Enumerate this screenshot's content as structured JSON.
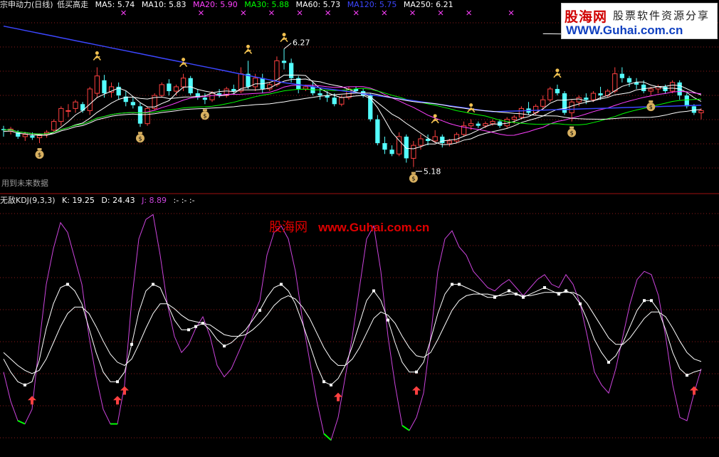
{
  "colors": {
    "background": "#000000",
    "grid": "#8b1a1a",
    "divider": "#a01010",
    "up_candle": "#ff4040",
    "down_candle": "#54ffff",
    "ma5": "#ffffff",
    "ma10": "#ffffff",
    "ma20": "#ff40ff",
    "ma30": "#00ff00",
    "ma60": "#ffffff",
    "ma120": "#3c46ff",
    "ma250": "#ffffff",
    "kdj_k": "#ffffff",
    "kdj_d": "#ffffff",
    "kdj_j": "#cc44dd",
    "j_low": "#00ff00",
    "buy_arrow": "#ff4040"
  },
  "top_panel": {
    "title": "宗申动力(日线)",
    "formula": "低买高走",
    "indicators": [
      {
        "label": "MA5: 5.74",
        "color": "#ffffff"
      },
      {
        "label": "MA10: 5.83",
        "color": "#ffffff"
      },
      {
        "label": "MA20: 5.90",
        "color": "#ff40ff"
      },
      {
        "label": "MA30: 5.88",
        "color": "#00ff00"
      },
      {
        "label": "MA60: 5.73",
        "color": "#ffffff"
      },
      {
        "label": "MA120: 5.75",
        "color": "#3c46ff"
      },
      {
        "label": "MA250: 6.21",
        "color": "#ffffff"
      }
    ],
    "footnote": "用到未来数据",
    "high_label": "6.27",
    "low_label": "5.18"
  },
  "bottom_panel": {
    "name": "无敌KDJ(9,3,3)",
    "values": [
      {
        "label": "K: 19.25",
        "color": "#ffffff"
      },
      {
        "label": "D: 24.43",
        "color": "#ffffff"
      },
      {
        "label": "J: 8.89",
        "color": "#cc44dd"
      },
      {
        "label": ":-  :-  :-",
        "color": "#ffffff"
      }
    ]
  },
  "logo": {
    "name": "股海网",
    "slogan": "股票软件资源分享",
    "url": "WWW.Guhai.com.cn"
  },
  "watermark": {
    "name": "股海网",
    "url": "www.Guhai.com.cn"
  },
  "chart_data": [
    {
      "type": "candlestick",
      "price_range": [
        5.0,
        6.55
      ],
      "candles": [
        [
          5.53,
          5.56,
          5.46,
          5.52
        ],
        [
          5.51,
          5.55,
          5.48,
          5.53
        ],
        [
          5.5,
          5.52,
          5.44,
          5.46
        ],
        [
          5.46,
          5.5,
          5.42,
          5.48
        ],
        [
          5.47,
          5.5,
          5.43,
          5.45
        ],
        [
          5.45,
          5.49,
          5.4,
          5.47
        ],
        [
          5.48,
          5.52,
          5.45,
          5.5
        ],
        [
          5.52,
          5.62,
          5.5,
          5.6
        ],
        [
          5.6,
          5.74,
          5.56,
          5.72
        ],
        [
          5.7,
          5.76,
          5.64,
          5.7
        ],
        [
          5.72,
          5.8,
          5.68,
          5.78
        ],
        [
          5.76,
          5.78,
          5.68,
          5.7
        ],
        [
          5.7,
          5.92,
          5.66,
          5.9
        ],
        [
          5.86,
          6.1,
          5.82,
          6.02
        ],
        [
          5.98,
          6.03,
          5.82,
          5.86
        ],
        [
          5.87,
          5.96,
          5.82,
          5.92
        ],
        [
          5.92,
          5.96,
          5.8,
          5.84
        ],
        [
          5.83,
          5.88,
          5.74,
          5.78
        ],
        [
          5.78,
          5.82,
          5.72,
          5.75
        ],
        [
          5.74,
          5.77,
          5.55,
          5.58
        ],
        [
          5.58,
          5.74,
          5.56,
          5.72
        ],
        [
          5.72,
          5.86,
          5.7,
          5.84
        ],
        [
          5.84,
          5.96,
          5.82,
          5.94
        ],
        [
          5.95,
          5.99,
          5.84,
          5.88
        ],
        [
          5.88,
          5.94,
          5.84,
          5.92
        ],
        [
          5.92,
          6.04,
          5.88,
          6.0
        ],
        [
          6.0,
          6.02,
          5.84,
          5.86
        ],
        [
          5.86,
          5.9,
          5.8,
          5.82
        ],
        [
          5.82,
          5.86,
          5.76,
          5.8
        ],
        [
          5.8,
          5.88,
          5.78,
          5.86
        ],
        [
          5.86,
          5.9,
          5.82,
          5.84
        ],
        [
          5.84,
          5.92,
          5.82,
          5.9
        ],
        [
          5.9,
          5.94,
          5.86,
          5.88
        ],
        [
          5.88,
          6.1,
          5.86,
          6.04
        ],
        [
          6.04,
          6.16,
          5.9,
          5.92
        ],
        [
          5.92,
          6.04,
          5.88,
          6.0
        ],
        [
          6.0,
          6.04,
          5.86,
          5.9
        ],
        [
          5.9,
          5.96,
          5.88,
          5.94
        ],
        [
          5.94,
          6.2,
          5.92,
          6.16
        ],
        [
          6.16,
          6.27,
          6.08,
          6.14
        ],
        [
          6.14,
          6.18,
          5.96,
          6.0
        ],
        [
          6.0,
          6.02,
          5.86,
          5.9
        ],
        [
          5.9,
          5.94,
          5.88,
          5.92
        ],
        [
          5.92,
          5.96,
          5.84,
          5.86
        ],
        [
          5.86,
          5.9,
          5.8,
          5.84
        ],
        [
          5.84,
          5.88,
          5.78,
          5.82
        ],
        [
          5.82,
          5.86,
          5.74,
          5.76
        ],
        [
          5.76,
          5.84,
          5.74,
          5.82
        ],
        [
          5.82,
          5.92,
          5.8,
          5.9
        ],
        [
          5.9,
          5.92,
          5.86,
          5.88
        ],
        [
          5.88,
          5.9,
          5.82,
          5.84
        ],
        [
          5.84,
          5.86,
          5.6,
          5.62
        ],
        [
          5.62,
          5.66,
          5.38,
          5.4
        ],
        [
          5.4,
          5.46,
          5.3,
          5.34
        ],
        [
          5.34,
          5.38,
          5.28,
          5.3
        ],
        [
          5.3,
          5.5,
          5.28,
          5.46
        ],
        [
          5.46,
          5.48,
          5.22,
          5.26
        ],
        [
          5.26,
          5.42,
          5.18,
          5.38
        ],
        [
          5.38,
          5.48,
          5.34,
          5.44
        ],
        [
          5.44,
          5.48,
          5.38,
          5.42
        ],
        [
          5.42,
          5.52,
          5.4,
          5.46
        ],
        [
          5.46,
          5.48,
          5.36,
          5.4
        ],
        [
          5.4,
          5.44,
          5.37,
          5.42
        ],
        [
          5.42,
          5.5,
          5.4,
          5.48
        ],
        [
          5.48,
          5.6,
          5.46,
          5.56
        ],
        [
          5.56,
          5.62,
          5.52,
          5.58
        ],
        [
          5.58,
          5.6,
          5.54,
          5.56
        ],
        [
          5.56,
          5.6,
          5.54,
          5.58
        ],
        [
          5.58,
          5.62,
          5.56,
          5.6
        ],
        [
          5.6,
          5.62,
          5.54,
          5.56
        ],
        [
          5.56,
          5.64,
          5.54,
          5.62
        ],
        [
          5.62,
          5.66,
          5.58,
          5.64
        ],
        [
          5.64,
          5.74,
          5.62,
          5.72
        ],
        [
          5.72,
          5.78,
          5.66,
          5.68
        ],
        [
          5.68,
          5.76,
          5.66,
          5.74
        ],
        [
          5.74,
          5.84,
          5.7,
          5.8
        ],
        [
          5.8,
          5.92,
          5.78,
          5.9
        ],
        [
          5.9,
          5.94,
          5.84,
          5.86
        ],
        [
          5.86,
          5.88,
          5.66,
          5.68
        ],
        [
          5.68,
          5.8,
          5.6,
          5.78
        ],
        [
          5.78,
          5.84,
          5.74,
          5.82
        ],
        [
          5.82,
          5.86,
          5.76,
          5.8
        ],
        [
          5.8,
          5.88,
          5.78,
          5.86
        ],
        [
          5.86,
          5.92,
          5.8,
          5.84
        ],
        [
          5.84,
          5.9,
          5.82,
          5.88
        ],
        [
          5.88,
          6.1,
          5.86,
          6.04
        ],
        [
          6.04,
          6.1,
          5.96,
          6.0
        ],
        [
          6.0,
          6.02,
          5.92,
          5.96
        ],
        [
          5.96,
          6.0,
          5.9,
          5.94
        ],
        [
          5.94,
          5.98,
          5.86,
          5.88
        ],
        [
          5.88,
          5.92,
          5.84,
          5.9
        ],
        [
          5.9,
          5.94,
          5.86,
          5.92
        ],
        [
          5.92,
          5.94,
          5.86,
          5.88
        ],
        [
          5.88,
          5.98,
          5.86,
          5.96
        ],
        [
          5.96,
          5.98,
          5.8,
          5.84
        ],
        [
          5.84,
          5.86,
          5.72,
          5.74
        ],
        [
          5.74,
          5.76,
          5.66,
          5.68
        ],
        [
          5.68,
          5.72,
          5.62,
          5.7
        ]
      ]
    },
    {
      "type": "line",
      "range": [
        -30,
        120
      ],
      "series": [
        {
          "name": "J",
          "values": [
            18,
            0,
            -12,
            -14,
            -5,
            35,
            72,
            94,
            110,
            104,
            88,
            72,
            40,
            15,
            -5,
            -14,
            -14,
            10,
            62,
            100,
            112,
            115,
            90,
            60,
            40,
            30,
            35,
            45,
            52,
            40,
            22,
            15,
            20,
            30,
            40,
            52,
            62,
            90,
            104,
            108,
            100,
            80,
            50,
            25,
            0,
            -20,
            -24,
            -10,
            15,
            40,
            70,
            100,
            108,
            80,
            40,
            10,
            -15,
            -18,
            -10,
            5,
            40,
            80,
            100,
            105,
            95,
            90,
            80,
            75,
            70,
            68,
            72,
            75,
            70,
            65,
            70,
            75,
            78,
            72,
            70,
            78,
            72,
            60,
            40,
            18,
            10,
            5,
            20,
            40,
            60,
            75,
            80,
            78,
            65,
            40,
            10,
            -10,
            -12,
            5,
            20
          ]
        },
        {
          "name": "K",
          "values": [
            26,
            18,
            12,
            10,
            12,
            25,
            45,
            60,
            70,
            72,
            68,
            60,
            45,
            30,
            18,
            12,
            12,
            18,
            35,
            55,
            68,
            72,
            70,
            60,
            50,
            44,
            44,
            46,
            48,
            44,
            38,
            34,
            36,
            40,
            44,
            50,
            56,
            64,
            70,
            72,
            68,
            60,
            48,
            35,
            22,
            12,
            10,
            14,
            22,
            34,
            48,
            62,
            68,
            62,
            50,
            36,
            24,
            18,
            18,
            24,
            38,
            54,
            66,
            72,
            72,
            70,
            68,
            66,
            64,
            64,
            66,
            68,
            66,
            64,
            66,
            68,
            70,
            68,
            66,
            68,
            66,
            60,
            50,
            38,
            30,
            24,
            28,
            36,
            46,
            56,
            62,
            62,
            56,
            44,
            30,
            20,
            16,
            18,
            19.25
          ]
        },
        {
          "name": "D",
          "values": [
            30,
            26,
            22,
            19,
            17,
            19,
            26,
            36,
            46,
            54,
            58,
            58,
            54,
            46,
            37,
            29,
            24,
            22,
            26,
            35,
            45,
            54,
            60,
            60,
            57,
            53,
            50,
            49,
            48,
            47,
            44,
            41,
            40,
            40,
            41,
            44,
            48,
            53,
            59,
            63,
            65,
            63,
            58,
            51,
            42,
            33,
            26,
            22,
            22,
            26,
            33,
            42,
            51,
            55,
            53,
            48,
            40,
            33,
            28,
            27,
            30,
            38,
            47,
            56,
            62,
            65,
            66,
            66,
            66,
            65,
            65,
            66,
            66,
            65,
            65,
            66,
            67,
            67,
            67,
            67,
            67,
            65,
            60,
            53,
            46,
            39,
            35,
            35,
            39,
            45,
            51,
            55,
            55,
            52,
            45,
            37,
            30,
            26,
            24.43
          ]
        }
      ]
    }
  ]
}
